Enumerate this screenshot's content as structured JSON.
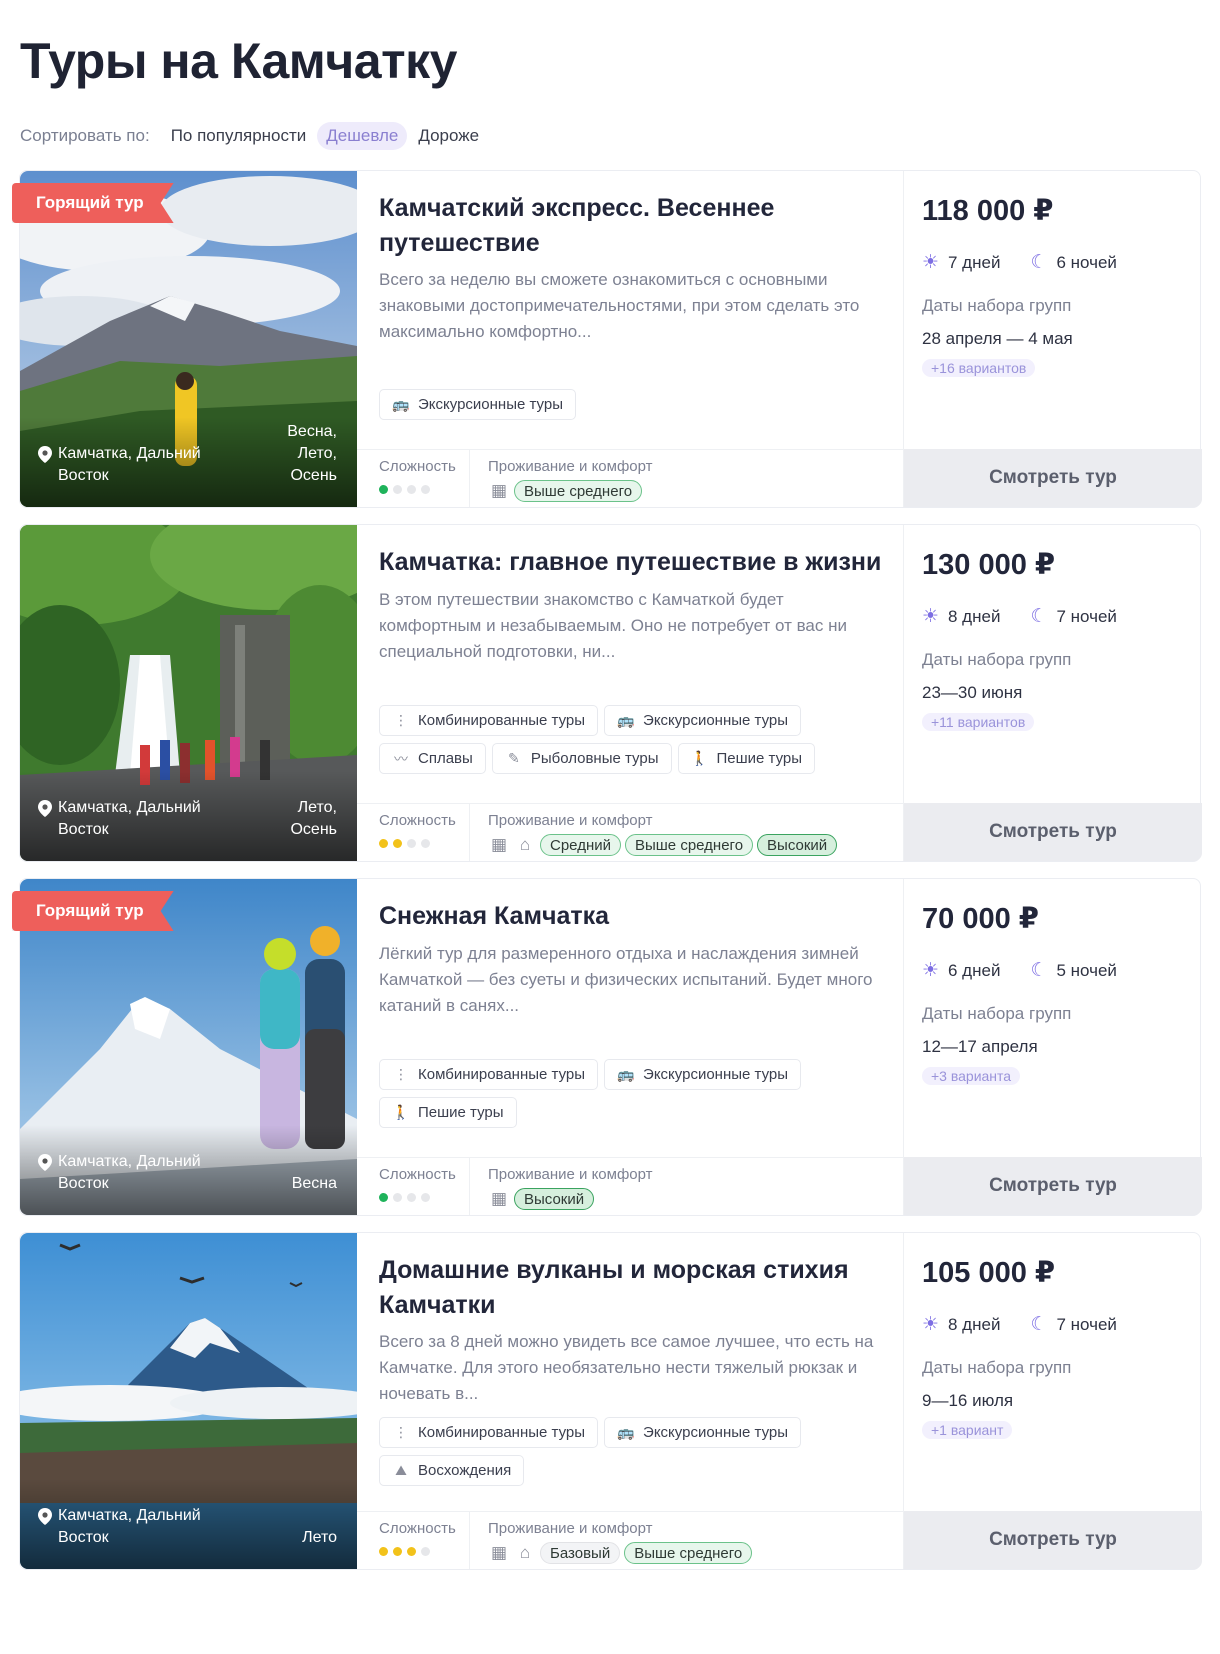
{
  "page": {
    "title": "Туры на Камчатку",
    "sort_label": "Сортировать по:",
    "sort_options": [
      "По популярности",
      "Дешевле",
      "Дороже"
    ],
    "active_sort": "Дешевле"
  },
  "labels": {
    "difficulty": "Сложность",
    "comfort": "Проживание и комфорт",
    "dates": "Даты набора групп",
    "view_button": "Смотреть тур",
    "hot_badge": "Горящий тур"
  },
  "colors": {
    "accent": "#7d6ee3",
    "hot": "#ee5f5b",
    "comfort_pill": "#e7f6ec",
    "difficulty_easy": "#1fb35b",
    "difficulty_medium": "#f2c21a"
  },
  "tours": [
    {
      "hot": true,
      "title": "Камчатский экспресс. Весеннее путешествие",
      "description": "Всего за неделю вы сможете ознакомиться с основными знаковыми достопримечательностями, при этом сделать это максимально комфортно...",
      "location": "Камчатка, Дальний Восток",
      "seasons": "Весна, Лето, Осень",
      "tags": [
        {
          "icon": "bus-icon",
          "label": "Экскурсионные туры"
        }
      ],
      "difficulty_level": 1,
      "comfort_icons": [
        "building-icon"
      ],
      "comfort": [
        "Выше среднего"
      ],
      "price": "118 000 ₽",
      "days": "7 дней",
      "nights": "6 ночей",
      "dates": "28 апреля — 4 мая",
      "variants": "+16 вариантов"
    },
    {
      "hot": false,
      "title": "Камчатка: главное путешествие в жизни",
      "description": "В этом путешествии знакомство с Камчаткой будет комфортным и незабываемым.  Оно не потребует от вас ни специальной подготовки, ни...",
      "location": "Камчатка, Дальний Восток",
      "seasons": "Лето, Осень",
      "tags": [
        {
          "icon": "route-icon",
          "label": "Комбинированные туры"
        },
        {
          "icon": "bus-icon",
          "label": "Экскурсионные туры"
        },
        {
          "icon": "rafting-icon",
          "label": "Сплавы"
        },
        {
          "icon": "fishing-icon",
          "label": "Рыболовные туры"
        },
        {
          "icon": "hiking-icon",
          "label": "Пешие туры"
        }
      ],
      "difficulty_level": 2,
      "comfort_icons": [
        "building-icon",
        "house-icon"
      ],
      "comfort": [
        "Средний",
        "Выше среднего",
        "Высокий"
      ],
      "price": "130 000 ₽",
      "days": "8 дней",
      "nights": "7 ночей",
      "dates": "23—30 июня",
      "variants": "+11 вариантов"
    },
    {
      "hot": true,
      "title": "Снежная Камчатка",
      "description": "Лёгкий тур для размеренного отдыха и наслаждения зимней Камчаткой — без суеты и физических испытаний.  Будет много катаний в санях...",
      "location": "Камчатка, Дальний Восток",
      "seasons": "Весна",
      "tags": [
        {
          "icon": "route-icon",
          "label": "Комбинированные туры"
        },
        {
          "icon": "bus-icon",
          "label": "Экскурсионные туры"
        },
        {
          "icon": "hiking-icon",
          "label": "Пешие туры"
        }
      ],
      "difficulty_level": 1,
      "comfort_icons": [
        "building-icon"
      ],
      "comfort": [
        "Высокий"
      ],
      "price": "70 000 ₽",
      "days": "6 дней",
      "nights": "5 ночей",
      "dates": "12—17 апреля",
      "variants": "+3 варианта"
    },
    {
      "hot": false,
      "title": "Домашние вулканы и морская стихия Камчатки",
      "description": "Всего за 8 дней можно увидеть все самое лучшее, что есть на Камчатке. Для этого необязательно нести тяжелый рюкзак и ночевать в...",
      "location": "Камчатка, Дальний Восток",
      "seasons": "Лето",
      "tags": [
        {
          "icon": "route-icon",
          "label": "Комбинированные туры"
        },
        {
          "icon": "bus-icon",
          "label": "Экскурсионные туры"
        },
        {
          "icon": "climbing-icon",
          "label": "Восхождения"
        }
      ],
      "difficulty_level": 3,
      "comfort_icons": [
        "building-icon",
        "house-icon"
      ],
      "comfort": [
        "Базовый",
        "Выше среднего"
      ],
      "price": "105 000 ₽",
      "days": "8 дней",
      "nights": "7 ночей",
      "dates": "9—16 июля",
      "variants": "+1 вариант"
    }
  ]
}
